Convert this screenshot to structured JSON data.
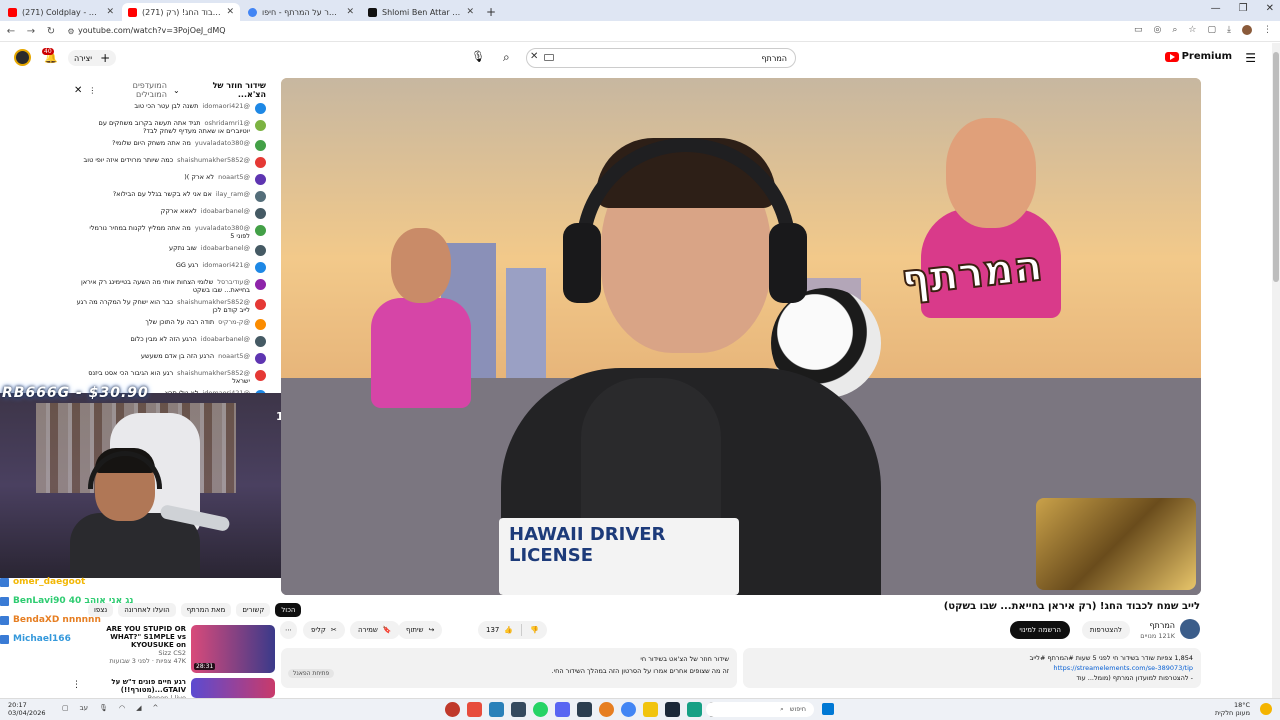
{
  "browser": {
    "tabs": [
      {
        "title": "(271) Coldplay - Viva La Vida (Of",
        "icon": "youtube-icon",
        "color": "#ff0000",
        "active": false
      },
      {
        "title": "(271) לייב שמח לכבוד החג! (רק",
        "icon": "youtube-icon",
        "color": "#ff0000",
        "active": true
      },
      {
        "title": "שלומי בן עטר על המרתף - חיפו",
        "icon": "google-icon",
        "color": "#4285f4",
        "active": false
      },
      {
        "title": "Shlomi Ben Attar (המרתף) (@m",
        "icon": "tiktok-icon",
        "color": "#111111",
        "active": false
      }
    ],
    "url": "youtube.com/watch?v=3PojOeJ_dMQ"
  },
  "yt": {
    "search_value": "המרתף",
    "premium": "Premium",
    "create_label": "יצירה",
    "notif_count": "40"
  },
  "chat": {
    "title": "שידור חוזר של הצ'א...",
    "top_label": "המועדפים המובילים",
    "messages": [
      {
        "user": "@idomaori421",
        "text": "תשנה לבן עטר הכי טוב",
        "color": "#1e88e5"
      },
      {
        "user": "@oshridamri1",
        "text": "תגיד אתה תעשה בקרוב משחקים עם יוטיוברים או שאתה מעדיף לשחק לבד?",
        "color": "#7cb342"
      },
      {
        "user": "@yuvaladato380",
        "text": "מה אתה משחק היום שלומי?",
        "color": "#43a047"
      },
      {
        "user": "@shaishumakher5852",
        "text": "כמה שיותר מרוידים איזה יופי טוב",
        "color": "#e53935"
      },
      {
        "user": "@noaart5",
        "text": "לא ארק )(",
        "color": "#5e35b1"
      },
      {
        "user": "@ilay_ram",
        "text": "אם אני לא בקשר בגלל עם הבילוא?",
        "color": "#546e7a"
      },
      {
        "user": "@idoabarbanel",
        "text": "לאאא ארקק",
        "color": "#455a64"
      },
      {
        "user": "@yuvaladato380",
        "text": "מה אתה ממליץ לקנות במחיר נורמלי לפוני 5",
        "color": "#43a047"
      },
      {
        "user": "@idoabarbanel",
        "text": "שוב נתקע",
        "color": "#455a64"
      },
      {
        "user": "@idomaori421",
        "text": "רגע GG",
        "color": "#1e88e5"
      },
      {
        "user": "@עודיברסל",
        "text": "שלומי הצחות אותי מה השעה בטיימינג רק איראן בחייאת... שבו בשקט",
        "color": "#8e24aa"
      },
      {
        "user": "@shaishumakher5852",
        "text": "כבר הוא ישחק על המקרה מה רגע לייב קודם לכן",
        "color": "#e53935"
      },
      {
        "user": "@ק-מרקיס",
        "text": "תודה רבה על התוכן שלך",
        "color": "#fb8c00"
      },
      {
        "user": "@idoabarbanel",
        "text": "הרגע הזה לא מבין כלום",
        "color": "#455a64"
      },
      {
        "user": "@noaart5",
        "text": "הרגע הזה בן אדם משעשע",
        "color": "#5e35b1"
      },
      {
        "user": "@shaishumakher5852",
        "text": "רגע הוא הגיבור הכי אסט ביזנס ישראל",
        "color": "#e53935"
      },
      {
        "user": "@idomaori421",
        "text": "לא טלי תרא",
        "color": "#1e88e5"
      }
    ]
  },
  "overlay": {
    "donation": "RB666G - $30.90",
    "trophy": "12",
    "rows": [
      {
        "text": "omer_daegoot",
        "color": "#f2b705"
      },
      {
        "text": "BenLavi90 40 נג אני אוהב",
        "color": "#2ecc71"
      },
      {
        "text": "BendaXD nnnnnn",
        "color": "#e67e22"
      },
      {
        "text": "Michael166",
        "color": "#3498db"
      }
    ]
  },
  "video": {
    "title": "לייב שמח לכבוד החג! (רק איראן בחייאת... שבו בשקט)",
    "brand_text": "המרתף",
    "shirt_text": "HAWAII DRIVER LICENSE",
    "channel": "המרתף",
    "subs": "121K מנויים",
    "join": "להצטרפות",
    "subscribed": "הרשמה למינוי",
    "likes": "137",
    "share": "שיתוף",
    "save": "שמירה",
    "clip": "קליפ",
    "desc_line1": "1,854 צפיות שודר בשידור חי לפני 5 שעות #המרתף #לייב",
    "desc_link": "https://streamelements.com/se-389073/tip",
    "desc_line2": "- להצטרפות למועדון המרתף (מומל...  עוד",
    "summary_title": "שידור חוזר של הצ'אט בשידור חי",
    "summary_text": "זה מה שצופים אחרים אמרו על הסרטון הזה במהלך השידור החי.",
    "summary_btn": "פתיחת הפאנל"
  },
  "filters": [
    "הכול",
    "קשורים",
    "מאת המרתף",
    "הועלו לאחרונה",
    "נצפו"
  ],
  "recommended": [
    {
      "title": "ARE YOU STUPID OR WHAT?\" S1MPLE vs KYOUSUKE on",
      "channel": "Sizz CS2",
      "meta": "47K צפיות · לפני 3 שבועות",
      "duration": "28:31",
      "thumb": "#d94a7a"
    },
    {
      "title": "רגע חיים פונים ד\"ש על GTAIV...(מטורף!!)",
      "channel": "Ronen | live",
      "meta": "",
      "duration": "",
      "thumb": "#5b4bd1"
    }
  ],
  "taskbar": {
    "time": "20:17",
    "date": "03/04/2026",
    "search": "חיפוש",
    "weather": "18°C",
    "weather_sub": "מעונן חלקית"
  }
}
